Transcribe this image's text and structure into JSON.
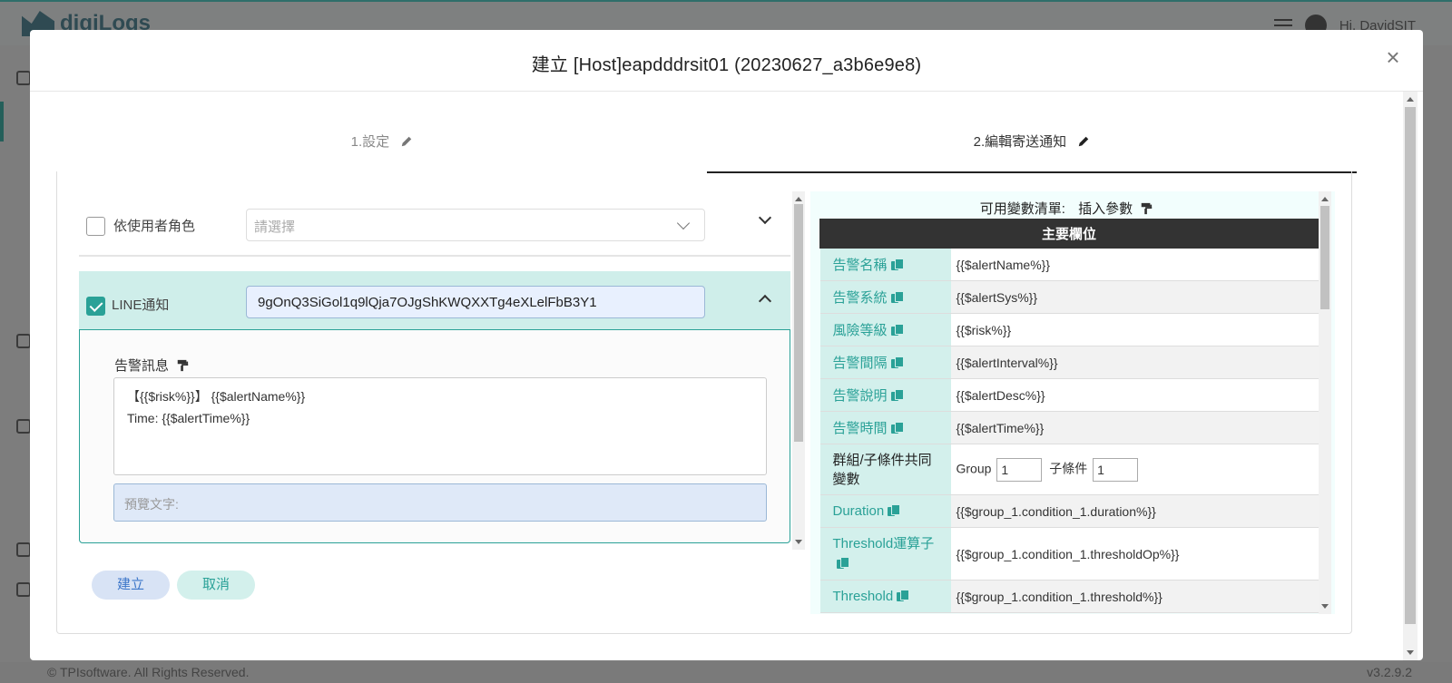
{
  "background": {
    "logo_text": "digiLogs",
    "user_greeting": "Hi, DavidSIT",
    "footer_copyright": "© TPIsoftware. All Rights Reserved.",
    "footer_version": "v3.2.9.2"
  },
  "modal": {
    "title": "建立 [Host]eapdddrsit01 (20230627_a3b6e9e8)",
    "close_label": "×"
  },
  "steps": [
    {
      "label": "1.設定",
      "active": false
    },
    {
      "label": "2.編輯寄送通知",
      "active": true
    }
  ],
  "role_row": {
    "checkbox_checked": false,
    "label": "依使用者角色",
    "select_placeholder": "請選擇"
  },
  "line_row": {
    "checkbox_checked": true,
    "label": "LINE通知",
    "token_value": "9gOnQ3SiGol1q9lQja7OJgShKWQXXTg4eXLelFbB3Y1"
  },
  "alert_message": {
    "label": "告警訊息",
    "line1": "【{{$risk%}}】 {{$alertName%}}",
    "line2": "Time: {{$alertTime%}}",
    "preview_placeholder": "預覽文字:"
  },
  "buttons": {
    "create": "建立",
    "cancel": "取消"
  },
  "variables": {
    "title": "可用變數清單:",
    "insert_label": "插入參數",
    "header": "主要欄位",
    "rows": [
      {
        "key": "告警名稱",
        "value": "{{$alertName%}}"
      },
      {
        "key": "告警系統",
        "value": "{{$alertSys%}}"
      },
      {
        "key": "風險等級",
        "value": "{{$risk%}}"
      },
      {
        "key": "告警間隔",
        "value": "{{$alertInterval%}}"
      },
      {
        "key": "告警說明",
        "value": "{{$alertDesc%}}"
      },
      {
        "key": "告警時間",
        "value": "{{$alertTime%}}"
      }
    ],
    "group_row": {
      "key": "群組/子條件共同變數",
      "group_label": "Group",
      "group_value": "1",
      "condition_label": "子條件",
      "condition_value": "1"
    },
    "condition_rows": [
      {
        "key": "Duration",
        "value": "{{$group_1.condition_1.duration%}}"
      },
      {
        "key": "Threshold運算子",
        "value": "{{$group_1.condition_1.thresholdOp%}}"
      },
      {
        "key": "Threshold",
        "value": "{{$group_1.condition_1.threshold%}}"
      }
    ]
  },
  "colors": {
    "accent": "#2aa197",
    "accent_light": "#d3f0ec",
    "primary_blue": "#3b76c9"
  }
}
